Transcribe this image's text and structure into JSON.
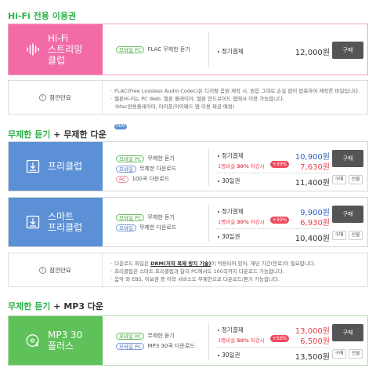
{
  "sections": {
    "hifi_title": "Hi-Fi 전용 이용권",
    "free_title_a": "무제한 듣기",
    "free_title_b": " + 무제한 다운",
    "drm_badge": "DRM",
    "mp3_title_a": "무제한 듣기",
    "mp3_title_b": " + MP3 다운"
  },
  "hifi": {
    "name": "Hi-Fi\n스트리밍\n클럽",
    "icon": "equalizer-icon",
    "features": [
      {
        "tag": "모바일 PC",
        "text": "FLAC 무제한 듣기"
      }
    ],
    "price_label": "정기결제",
    "price": "12,000원",
    "buy": "구매"
  },
  "notice1": {
    "label": "잠깐만요",
    "lines": [
      "FLAC(Free Lossless Audio Codec)은 디지털 음원 제작 시, 원음 그대로 손실 없이 압축하여 제작한 파일입니다.",
      "멜론Hi-Fi는 PC Web, 멜론 플레이어, 멜론 안드로이드 앱에서 이용 가능합니다.",
      "(Mac전용플레이어, 아이폰/아이패드 앱 이용 제공 예정)"
    ]
  },
  "freeclub": {
    "name": "프리클럽",
    "icon": "download-box-icon",
    "features": [
      {
        "tag": "모바일 PC",
        "tagc": "g",
        "text": "무제한 듣기"
      },
      {
        "tag": "모바일",
        "tagc": "b",
        "text": "무제한 다운로드"
      },
      {
        "tag": "PC",
        "tagc": "p",
        "text": "100곡 다운로드"
      }
    ],
    "row1_label": "정기결제",
    "row1_price": "10,900원",
    "row2_label_a": "1명비실 ",
    "row2_label_b": "30%",
    "row2_label_c": " 하강시",
    "row2_badge": "+30%",
    "row2_price": "7,630원",
    "row3_label": "30일권",
    "row3_price": "11,400원",
    "buy": "구매",
    "btn_a": "구매",
    "btn_b": "선물"
  },
  "smartclub": {
    "name": "스마트\n프리클럽",
    "icon": "download-box-icon",
    "features": [
      {
        "tag": "모바일 PC",
        "tagc": "g",
        "text": "무제한 듣기"
      },
      {
        "tag": "모바일",
        "tagc": "b",
        "text": "무제한 다운로드"
      }
    ],
    "row1_label": "정기결제",
    "row1_price": "9,900원",
    "row2_label_a": "1명비실 ",
    "row2_label_b": "30%",
    "row2_label_c": " 하강시",
    "row2_badge": "+30%",
    "row2_price": "6,930원",
    "row3_label": "30일권",
    "row3_price": "10,400원",
    "buy": "구매",
    "btn_a": "구매",
    "btn_b": "선물"
  },
  "notice2": {
    "label": "잠깐만요",
    "line1_a": "다운로드 파일은 ",
    "line1_b": "DRM(저작 복제 방지 기술)",
    "line1_c": "이 적용되어 있어, 해당 기간(만료)이 필요합니다.",
    "line2": "프리클럽은 스마트 프리클럽과 달리 PC에서도 100곡까지 다운로드 가능합니다.",
    "line3": "음악 외 EBS, 이보권 등 어학 서비스도 무제한으로 다운로드/듣기 가능합니다."
  },
  "mp3": {
    "name": "MP3 30\n플러스",
    "icon": "disc-download-icon",
    "features": [
      {
        "tag": "모바일 PC",
        "tagc": "g",
        "text": "무제한 듣기"
      },
      {
        "tag": "모바일 PC",
        "tagc": "b",
        "text": "MP3 30곡 다운로드"
      }
    ],
    "row1_label": "정기결제",
    "row1_price": "13,000원",
    "row2_label_a": "1명비실 ",
    "row2_label_b": "50%",
    "row2_label_c": " 하강시",
    "row2_badge": "+50%",
    "row2_price": "6,500원",
    "row3_label": "30일권",
    "row3_price": "13,500원",
    "buy": "구매",
    "btn_a": "구매",
    "btn_b": "선물"
  },
  "colors": {
    "hifi": "#f26ba6",
    "blue": "#5b8fd6",
    "green": "#5fc15a",
    "title_green": "#2db34a"
  }
}
